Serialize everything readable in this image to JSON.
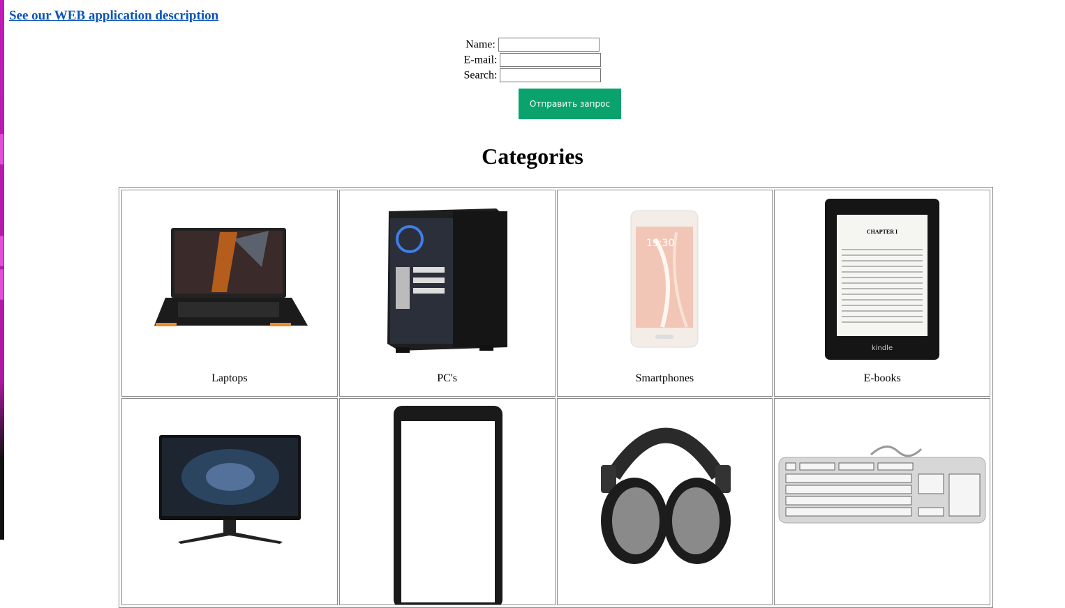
{
  "header": {
    "link_text": "See our WEB application description"
  },
  "form": {
    "name_label": "Name:",
    "email_label": "E-mail:",
    "search_label": "Search:",
    "name_value": "",
    "email_value": "",
    "search_value": "",
    "submit_label": "Отправить запрос"
  },
  "categories": {
    "heading": "Categories",
    "items": [
      {
        "label": "Laptops",
        "icon": "laptop-icon"
      },
      {
        "label": "PC's",
        "icon": "pc-tower-icon"
      },
      {
        "label": "Smartphones",
        "icon": "smartphone-icon"
      },
      {
        "label": "E-books",
        "icon": "ebook-reader-icon"
      },
      {
        "label": "",
        "icon": "monitor-icon"
      },
      {
        "label": "",
        "icon": "tablet-icon"
      },
      {
        "label": "",
        "icon": "headphones-icon"
      },
      {
        "label": "",
        "icon": "keyboard-icon"
      }
    ],
    "ebook_screen": {
      "chapter": "CHAPTER I",
      "brand": "kindle"
    }
  },
  "colors": {
    "link": "#0a55b8",
    "submit_bg": "#0aa36e",
    "border": "#8a8a8a"
  }
}
